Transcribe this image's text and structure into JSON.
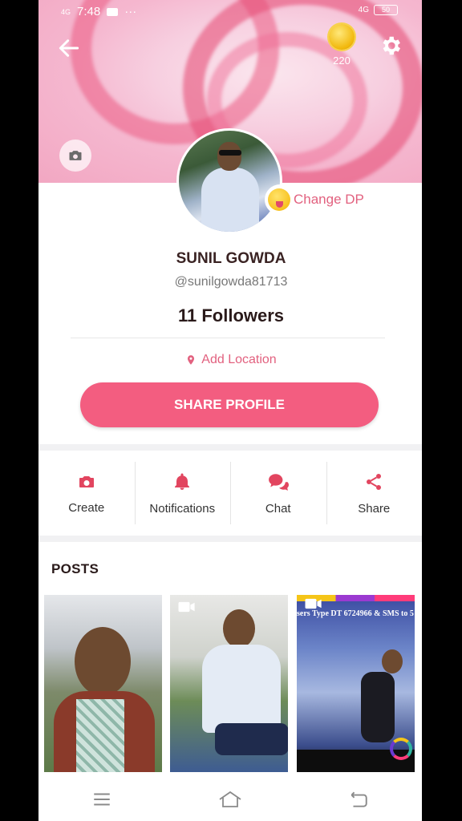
{
  "status_bar": {
    "time": "7:48",
    "signal_left": "4G",
    "network_right": "4G",
    "battery": "50"
  },
  "cover": {
    "coin_count": "220",
    "icons": [
      "back-arrow-icon",
      "coin-icon",
      "gear-icon",
      "camera-icon"
    ]
  },
  "profile": {
    "name": "SUNIL GOWDA",
    "handle": "@sunilgowda81713",
    "followers": "11 Followers",
    "change_dp_label": "Change DP",
    "add_location_label": "Add Location",
    "share_profile_label": "SHARE PROFILE"
  },
  "actions": [
    {
      "label": "Create",
      "icon": "camera-icon"
    },
    {
      "label": "Notifications",
      "icon": "bell-icon"
    },
    {
      "label": "Chat",
      "icon": "chat-icon"
    },
    {
      "label": "Share",
      "icon": "share-icon"
    }
  ],
  "posts": {
    "title": "POSTS",
    "third_thumb_caption": "sers Type DT 6724966 & SMS to 5"
  },
  "nav": [
    "menu-icon",
    "home-icon",
    "back-icon"
  ],
  "colors": {
    "accent": "#f35d80",
    "accent_text": "#e2617f",
    "background": "#f1f1f3"
  }
}
